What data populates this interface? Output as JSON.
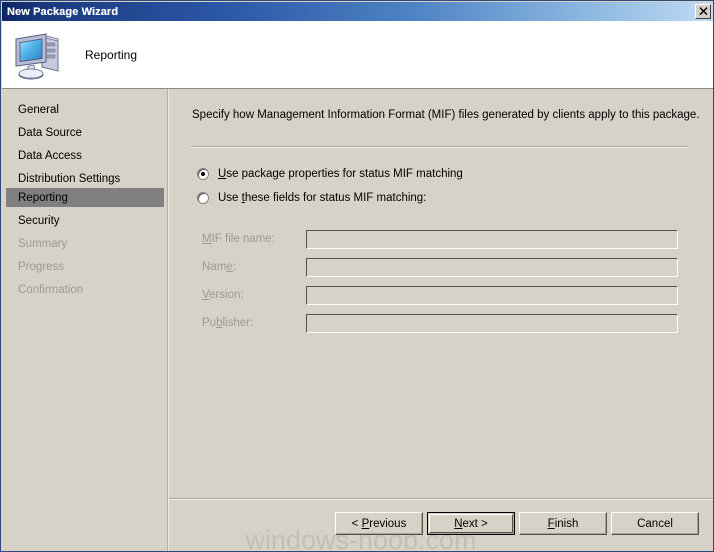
{
  "window": {
    "title": "New Package Wizard",
    "close_label": "✕",
    "close_icon": "close-icon"
  },
  "header": {
    "icon": "computer-monitor-icon",
    "title": "Reporting"
  },
  "sidebar": {
    "items": [
      {
        "label": "General",
        "state": "enabled"
      },
      {
        "label": "Data Source",
        "state": "enabled"
      },
      {
        "label": "Data Access",
        "state": "enabled"
      },
      {
        "label": "Distribution Settings",
        "state": "enabled"
      },
      {
        "label": "Reporting",
        "state": "selected"
      },
      {
        "label": "Security",
        "state": "enabled"
      },
      {
        "label": "Summary",
        "state": "disabled"
      },
      {
        "label": "Progress",
        "state": "disabled"
      },
      {
        "label": "Confirmation",
        "state": "disabled"
      }
    ]
  },
  "content": {
    "description": "Specify how Management Information Format (MIF) files generated by clients apply to this package.",
    "radios": [
      {
        "name": "use-package-properties",
        "before": "",
        "accel": "U",
        "after": "se package properties for status MIF matching",
        "checked": true
      },
      {
        "name": "use-these-fields",
        "before": "Use ",
        "accel": "t",
        "after": "hese fields for status MIF matching:",
        "checked": false
      }
    ],
    "fields": [
      {
        "name": "mif-file-name",
        "before": "",
        "accel": "M",
        "after": "IF file name:",
        "value": "",
        "placeholder": "",
        "disabled": true
      },
      {
        "name": "name",
        "before": "Nam",
        "accel": "e",
        "after": ":",
        "value": "",
        "placeholder": "",
        "disabled": true
      },
      {
        "name": "version",
        "before": "",
        "accel": "V",
        "after": "ersion:",
        "value": "",
        "placeholder": "",
        "disabled": true
      },
      {
        "name": "publisher",
        "before": "Pu",
        "accel": "b",
        "after": "lisher:",
        "value": "",
        "placeholder": "",
        "disabled": true
      }
    ]
  },
  "footer": {
    "buttons": [
      {
        "name": "previous",
        "before": "< ",
        "accel": "P",
        "after": "revious",
        "default": false
      },
      {
        "name": "next",
        "before": "",
        "accel": "N",
        "after": "ext >",
        "default": true
      },
      {
        "name": "finish",
        "before": "",
        "accel": "F",
        "after": "inish",
        "default": false
      },
      {
        "name": "cancel",
        "before": "Cancel",
        "accel": "",
        "after": "",
        "default": false
      }
    ]
  },
  "watermark": {
    "text": "windows-noob.com"
  },
  "colors": {
    "dialog_face": "#d6d2c8",
    "title_dark": "#0c2461",
    "title_light": "#c9def5",
    "selection": "#808080",
    "disabled_text": "#9a9a94"
  }
}
